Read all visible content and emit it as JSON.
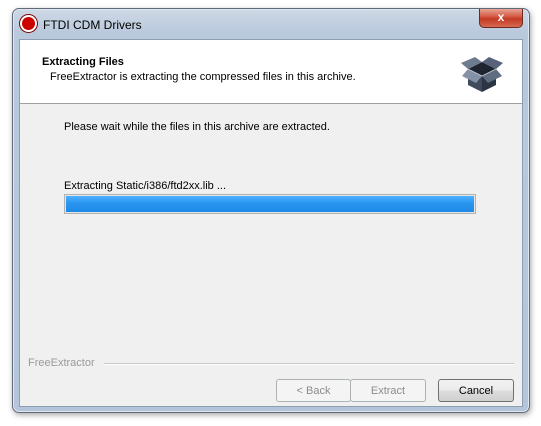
{
  "window": {
    "title": "FTDI CDM Drivers",
    "close_glyph": "x"
  },
  "header": {
    "title": "Extracting Files",
    "subtitle": "FreeExtractor is extracting the compressed files in this archive.",
    "icon": "open-box-icon"
  },
  "body": {
    "wait_text": "Please wait while the files in this archive are extracted.",
    "status_text": "Extracting Static/i386/ftd2xx.lib ...",
    "progress_fraction": 1.0
  },
  "footer": {
    "brand": "FreeExtractor",
    "back_label": "< Back",
    "back_enabled": false,
    "extract_label": "Extract",
    "extract_enabled": false,
    "cancel_label": "Cancel",
    "cancel_enabled": true
  },
  "colors": {
    "progress": "#2a96f0",
    "close_button": "#c33a24"
  }
}
